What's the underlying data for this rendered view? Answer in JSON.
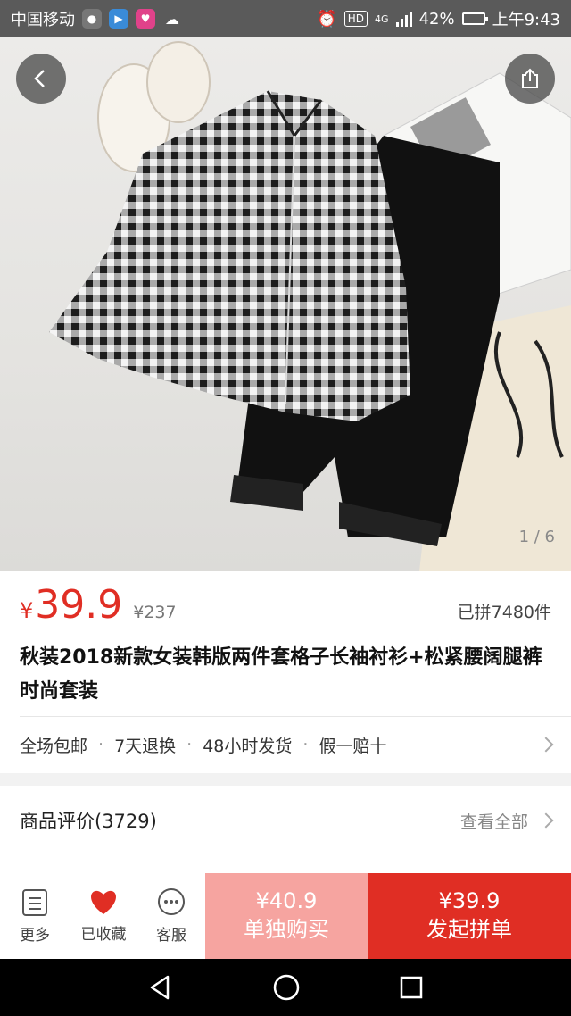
{
  "status_bar": {
    "carrier": "中国移动",
    "hd": "HD",
    "network": "4G",
    "battery": "42%",
    "time": "上午9:43",
    "battery_level": 0.42
  },
  "gallery": {
    "page_counter": "1 / 6"
  },
  "product": {
    "currency": "¥",
    "price": "39.9",
    "original_price": "¥237",
    "sold": "已拼7480件",
    "title": "秋装2018新款女装韩版两件套格子长袖衬衫+松紧腰阔腿裤时尚套装",
    "services": [
      "全场包邮",
      "7天退换",
      "48小时发货",
      "假一赔十"
    ],
    "service_separator": "·"
  },
  "reviews": {
    "title": "商品评价(3729)",
    "view_all": "查看全部"
  },
  "bottom_bar": {
    "more": "更多",
    "favorited": "已收藏",
    "service": "客服",
    "buy_alone_price": "¥40.9",
    "buy_alone_label": "单独购买",
    "group_price": "¥39.9",
    "group_label": "发起拼单"
  },
  "colors": {
    "accent": "#e02e24",
    "accent_light": "#f6a4a0"
  }
}
